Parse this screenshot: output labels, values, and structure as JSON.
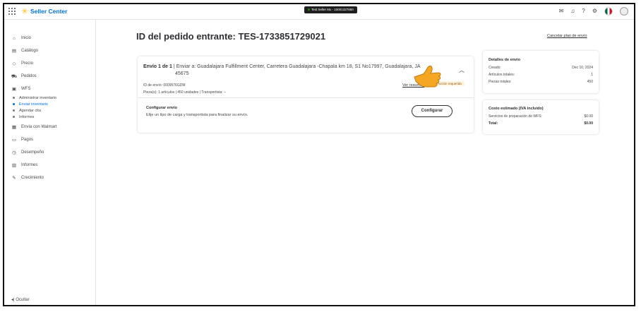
{
  "app": {
    "brand": "Seller Center",
    "seller_badge": "Test Seller Mx - 10001327860"
  },
  "topbar": {
    "icons": [
      "mail-icon",
      "bell-icon",
      "help-icon",
      "gear-icon",
      "mexico-flag-icon",
      "avatar-icon"
    ]
  },
  "sidebar": {
    "items": [
      {
        "label": "Inicio",
        "icon": "home-icon",
        "glyph": "⌂"
      },
      {
        "label": "Catálogo",
        "icon": "catalog-icon",
        "glyph": "▤"
      },
      {
        "label": "Precio",
        "icon": "tag-icon",
        "glyph": "◇"
      },
      {
        "label": "Pedidos",
        "icon": "cart-icon",
        "glyph": "⛟"
      },
      {
        "label": "WFS",
        "icon": "warehouse-icon",
        "glyph": "▣"
      }
    ],
    "wfs_sub": [
      {
        "label": "Administrar inventario",
        "active": false
      },
      {
        "label": "Enviar inventario",
        "active": true
      },
      {
        "label": "Agendar cita",
        "active": false
      },
      {
        "label": "Informes",
        "active": false
      }
    ],
    "items2": [
      {
        "label": "Envía con Walmart",
        "icon": "truck-icon",
        "glyph": "▦"
      },
      {
        "label": "Pagos",
        "icon": "payments-icon",
        "glyph": "▭"
      },
      {
        "label": "Desempeño",
        "icon": "performance-icon",
        "glyph": "◷"
      },
      {
        "label": "Informes",
        "icon": "reports-icon",
        "glyph": "▥"
      },
      {
        "label": "Crecimiento",
        "icon": "growth-icon",
        "glyph": "✎"
      }
    ],
    "hide_label": "Ocultar"
  },
  "main": {
    "title": "ID del pedido entrante: TES-1733851729021",
    "cancel_link": "Cancelar plan de envío",
    "shipment": {
      "number": "Envío 1 de 1",
      "to_line1": "| Enviar a: Guadalajara Fulfillment Center, Carretera Guadalajara -Chapala km 18, S1 No17997, Guadalajara, JA",
      "to_line2": "45675",
      "shipment_id": "ID de envío: 0009576GDM",
      "pieces": "Pieza(s): 1 artículos | 450 unidades | Transportista: --",
      "summary_link": "Ver resumen",
      "action_badge": "Acción requerida",
      "config_title": "Configurar envío",
      "config_desc": "Elije un tipo de carga y transportista para finalizar su envío.",
      "config_button": "Configurar"
    },
    "details": {
      "title": "Detalles de envío",
      "rows": [
        {
          "label": "Creado:",
          "value": "Dec 10, 2024"
        },
        {
          "label": "Artículos totales:",
          "value": "1"
        },
        {
          "label": "Piezas totales:",
          "value": "450"
        }
      ]
    },
    "cost": {
      "title": "Costo estimado (IVA incluido)",
      "rows": [
        {
          "label": "Servicios de preparación de WFS:",
          "value": "$0.00"
        },
        {
          "label": "Total:",
          "value": "$0.00"
        }
      ]
    }
  },
  "colors": {
    "accent": "#0071dc",
    "spark": "#ffc220",
    "pointer": "#f5a623"
  }
}
